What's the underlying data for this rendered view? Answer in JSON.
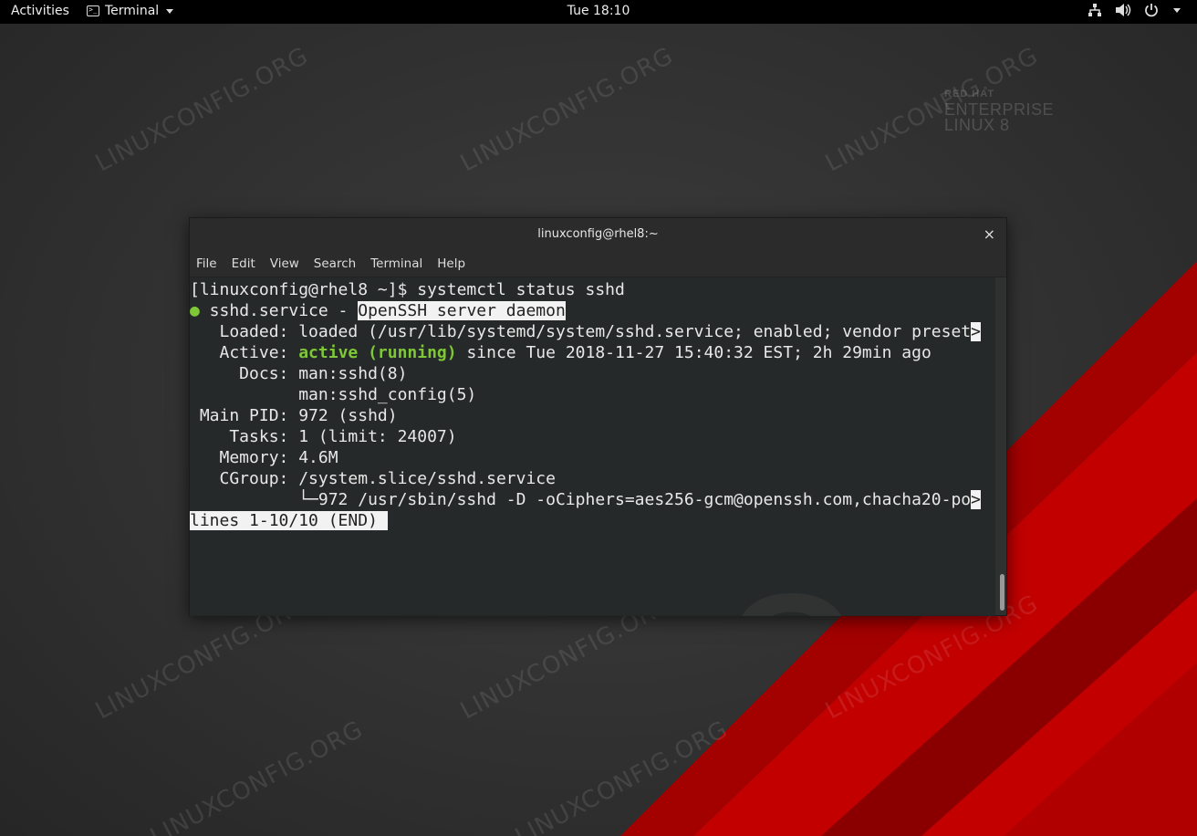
{
  "topbar": {
    "activities": "Activities",
    "app_name": "Terminal",
    "clock": "Tue 18:10",
    "tray_icons": [
      "network-icon",
      "volume-icon",
      "power-icon",
      "chevron-down-icon"
    ]
  },
  "desktop": {
    "watermark": "LINUXCONFIG.ORG",
    "brand": {
      "line1": "RED HAT",
      "line2": "ENTERPRISE",
      "line3": "LINUX 8"
    },
    "big_number": "8",
    "colors": {
      "red_stripe": "#c00000",
      "dark_red": "#8a0000",
      "background": "#333333"
    }
  },
  "window": {
    "title": "linuxconfig@rhel8:~",
    "close": "×",
    "menu": [
      "File",
      "Edit",
      "View",
      "Search",
      "Terminal",
      "Help"
    ]
  },
  "terminal": {
    "prompt_line": "[linuxconfig@rhel8 ~]$ systemctl status sshd",
    "unit_name": " sshd.service - ",
    "unit_desc": "OpenSSH server daemon",
    "dot": "●",
    "loaded": "   Loaded: loaded (/usr/lib/systemd/system/sshd.service; enabled; vendor preset",
    "truncate_marker": ">",
    "active_label": "   Active: ",
    "active_state": "active (running)",
    "active_rest": " since Tue 2018-11-27 15:40:32 EST; 2h 29min ago",
    "docs1": "     Docs: man:sshd(8)",
    "docs2": "           man:sshd_config(5)",
    "main_pid": " Main PID: 972 (sshd)",
    "tasks": "    Tasks: 1 (limit: 24007)",
    "memory": "   Memory: 4.6M",
    "cgroup": "   CGroup: /system.slice/sshd.service",
    "process": "           └─972 /usr/sbin/sshd -D -oCiphers=aes256-gcm@openssh.com,chacha20-po",
    "pager_status": "lines 1-10/10 (END) "
  }
}
